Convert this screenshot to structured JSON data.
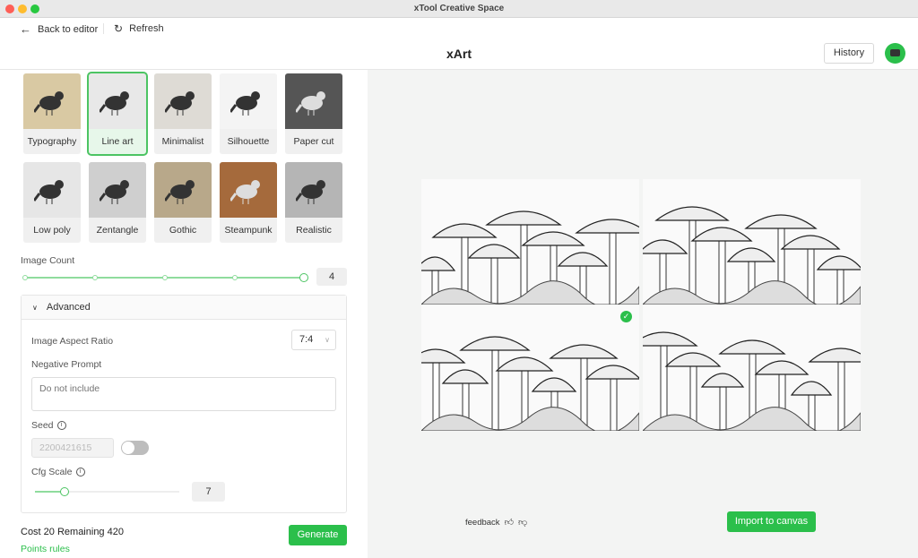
{
  "window": {
    "title": "xTool Creative Space"
  },
  "toolbar": {
    "back": "Back to editor",
    "refresh": "Refresh"
  },
  "header": {
    "title": "xArt",
    "history": "History"
  },
  "styles": [
    {
      "label": "Typography",
      "bg": "#d9c9a3"
    },
    {
      "label": "Line art",
      "bg": "#e8e8e8",
      "selected": true
    },
    {
      "label": "Minimalist",
      "bg": "#dedbd5"
    },
    {
      "label": "Silhouette",
      "bg": "#f4f4f4"
    },
    {
      "label": "Paper cut",
      "bg": "#555555"
    },
    {
      "label": "Low poly",
      "bg": "#e6e6e6"
    },
    {
      "label": "Zentangle",
      "bg": "#cfcfcf"
    },
    {
      "label": "Gothic",
      "bg": "#b8a88a"
    },
    {
      "label": "Steampunk",
      "bg": "#a56a3c"
    },
    {
      "label": "Realistic",
      "bg": "#b5b5b5"
    }
  ],
  "image_count": {
    "label": "Image Count",
    "value": "4",
    "min": 1,
    "max": 4
  },
  "advanced": {
    "label": "Advanced",
    "aspect_label": "Image Aspect Ratio",
    "aspect_value": "7:4",
    "negative_label": "Negative Prompt",
    "negative_placeholder": "Do not include",
    "seed_label": "Seed",
    "seed_value": "2200421615",
    "seed_toggle": false,
    "cfg_label": "Cfg Scale",
    "cfg_value": "7"
  },
  "footer": {
    "cost": "Cost 20 Remaining 420",
    "points_rules": "Points rules",
    "generate": "Generate"
  },
  "results": {
    "feedback": "feedback",
    "import": "Import to canvas",
    "selected_index": 2
  },
  "colors": {
    "accent": "#2bbf4b"
  }
}
